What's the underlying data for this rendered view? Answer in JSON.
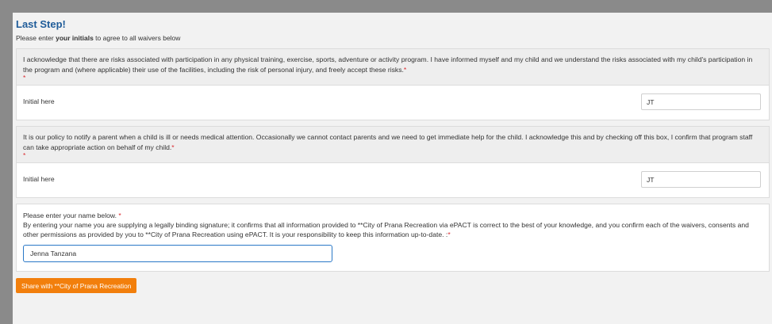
{
  "header": {
    "title": "Last Step!",
    "subtitle_pre": "Please enter ",
    "subtitle_bold": "your initials",
    "subtitle_post": " to agree to all waivers below"
  },
  "waivers": [
    {
      "text": "I acknowledge that there are risks associated with participation in any physical training, exercise, sports, adventure or activity program. I have informed myself and my child and we understand the risks associated with my child's participation in the program and (where applicable) their use of the facilities, including the risk of personal injury, and freely accept these risks.",
      "required_mark": "*",
      "initial_label": "Initial here",
      "initial_value": "JT"
    },
    {
      "text": "It is our policy to notify a parent when a child is ill or needs medical attention. Occasionally we cannot contact parents and we need to get immediate help for the child. I acknowledge this and by checking off this box,  I confirm that program staff can take appropriate action on behalf of my child.",
      "required_mark": "*",
      "initial_label": "Initial here",
      "initial_value": "JT"
    }
  ],
  "signature": {
    "prompt": "Please enter your name below. ",
    "prompt_required": "*",
    "legal_text": "By entering your name you are supplying a legally binding signature; it confirms that all information provided to **City of Prana Recreation via ePACT is correct to the best of your knowledge, and you confirm each of the waivers, consents and other permissions as provided by you to **City of Prana Recreation using ePACT. It is your responsibility to keep this information up-to-date. :",
    "legal_required": "*",
    "name_value": "Jenna Tanzana"
  },
  "share_button": {
    "label": "Share with **City of Prana Recreation"
  },
  "colors": {
    "title": "#1f5c99",
    "required": "#d9262b",
    "button": "#f27f0c",
    "input_focus": "#2a78c7"
  }
}
